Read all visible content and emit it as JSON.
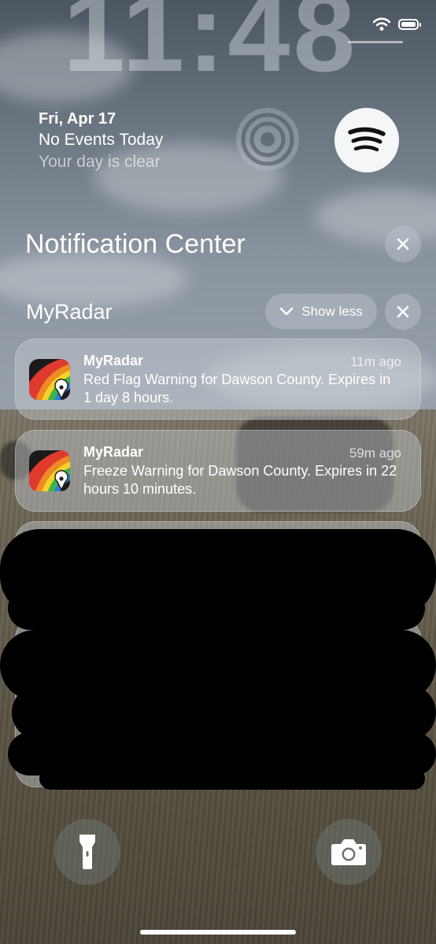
{
  "status_bar": {
    "time": "11:48",
    "wifi_icon": "wifi-icon",
    "battery_icon": "battery-icon"
  },
  "date_widget": {
    "date": "Fri, Apr 17",
    "events": "No Events Today",
    "subtitle": "Your day is clear"
  },
  "widgets": {
    "left_icon": "now-playing-broadcast-icon",
    "right_icon": "spotify-icon"
  },
  "notification_center": {
    "title": "Notification Center",
    "clear_icon": "close-icon"
  },
  "app_group": {
    "name": "MyRadar",
    "show_less_label": "Show less",
    "chevron_icon": "chevron-down-icon",
    "close_icon": "close-icon"
  },
  "notifications": [
    {
      "app": "MyRadar",
      "time": "11m ago",
      "body": "Red Flag Warning for Dawson County. Expires in 1 day 8 hours."
    },
    {
      "app": "MyRadar",
      "time": "59m ago",
      "body": "Freeze Warning for Dawson County. Expires in 22 hours 10 minutes."
    }
  ],
  "bottom_controls": {
    "left_icon": "flashlight-icon",
    "right_icon": "camera-icon"
  },
  "colors": {
    "accent": "#ffffff",
    "notification_bg": "#c8ced4",
    "redaction": "#000000"
  }
}
